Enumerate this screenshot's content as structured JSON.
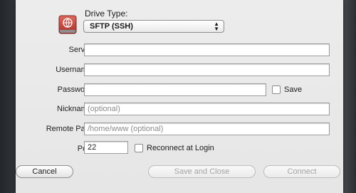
{
  "drive_type": {
    "label": "Drive Type:",
    "value": "SFTP (SSH)",
    "icon": "drive-icon"
  },
  "fields": {
    "server": {
      "label": "Server:",
      "value": "",
      "placeholder": ""
    },
    "username": {
      "label": "Username:",
      "value": "",
      "placeholder": ""
    },
    "password": {
      "label": "Password:",
      "value": "",
      "placeholder": ""
    },
    "nickname": {
      "label": "Nickname:",
      "value": "",
      "placeholder": "(optional)"
    },
    "remote_path": {
      "label": "Remote Path:",
      "value": "",
      "placeholder": "/home/www (optional)"
    },
    "port": {
      "label": "Port:",
      "value": "22"
    }
  },
  "save_checkbox": {
    "label": "Save",
    "checked": false
  },
  "reconnect_checkbox": {
    "label": "Reconnect at Login",
    "checked": false
  },
  "buttons": {
    "cancel": "Cancel",
    "save_and_close": "Save and Close",
    "connect": "Connect"
  },
  "colors": {
    "sheet_bg": "#ececec",
    "icon_red": "#c8453c",
    "disabled_text": "#a3a3a3"
  }
}
